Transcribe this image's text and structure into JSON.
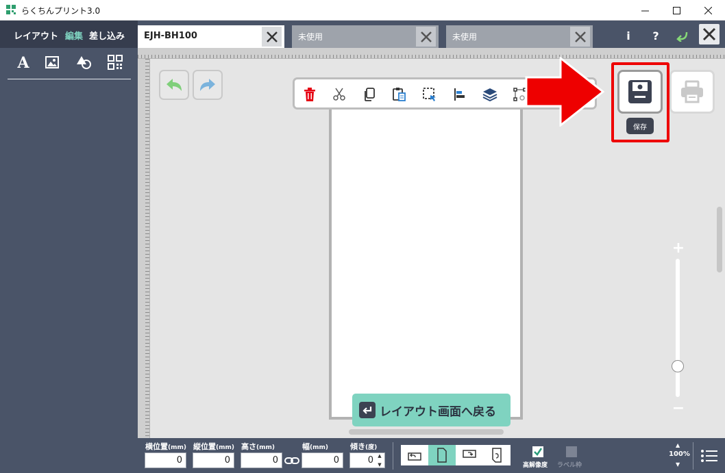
{
  "window": {
    "title": "らくちんプリント3.0",
    "minimize": "—",
    "maximize": "☐",
    "close": "✕"
  },
  "sidebar": {
    "tabs": [
      {
        "label": "レイアウト"
      },
      {
        "label": "編集"
      },
      {
        "label": "差し込み"
      }
    ],
    "tools": [
      "text-tool-icon",
      "image-tool-icon",
      "shape-tool-icon",
      "qr-tool-icon"
    ]
  },
  "doc_tabs": [
    {
      "label": "EJH-BH100"
    },
    {
      "label": "未使用"
    },
    {
      "label": "未使用"
    }
  ],
  "header": {
    "info": "i",
    "help": "?"
  },
  "toolbar": {
    "save_tooltip": "保存"
  },
  "back_button": {
    "label": "レイアウト画面へ戻る"
  },
  "bottom": {
    "x_label": "横位置",
    "y_label": "縦位置",
    "h_label": "高さ",
    "w_label": "幅",
    "unit_mm": "(mm)",
    "angle_label": "傾き",
    "angle_unit": "(度)",
    "x_value": "0",
    "y_value": "0",
    "h_value": "0",
    "w_value": "0",
    "angle_value": "0",
    "high_res_label": "高解像度",
    "label_frame_label": "ラベル枠",
    "zoom_level": "100%"
  },
  "colors": {
    "dark": "#4a5468",
    "accent": "#7fd3c0",
    "highlight": "#ee0000",
    "delete": "#e60012"
  }
}
